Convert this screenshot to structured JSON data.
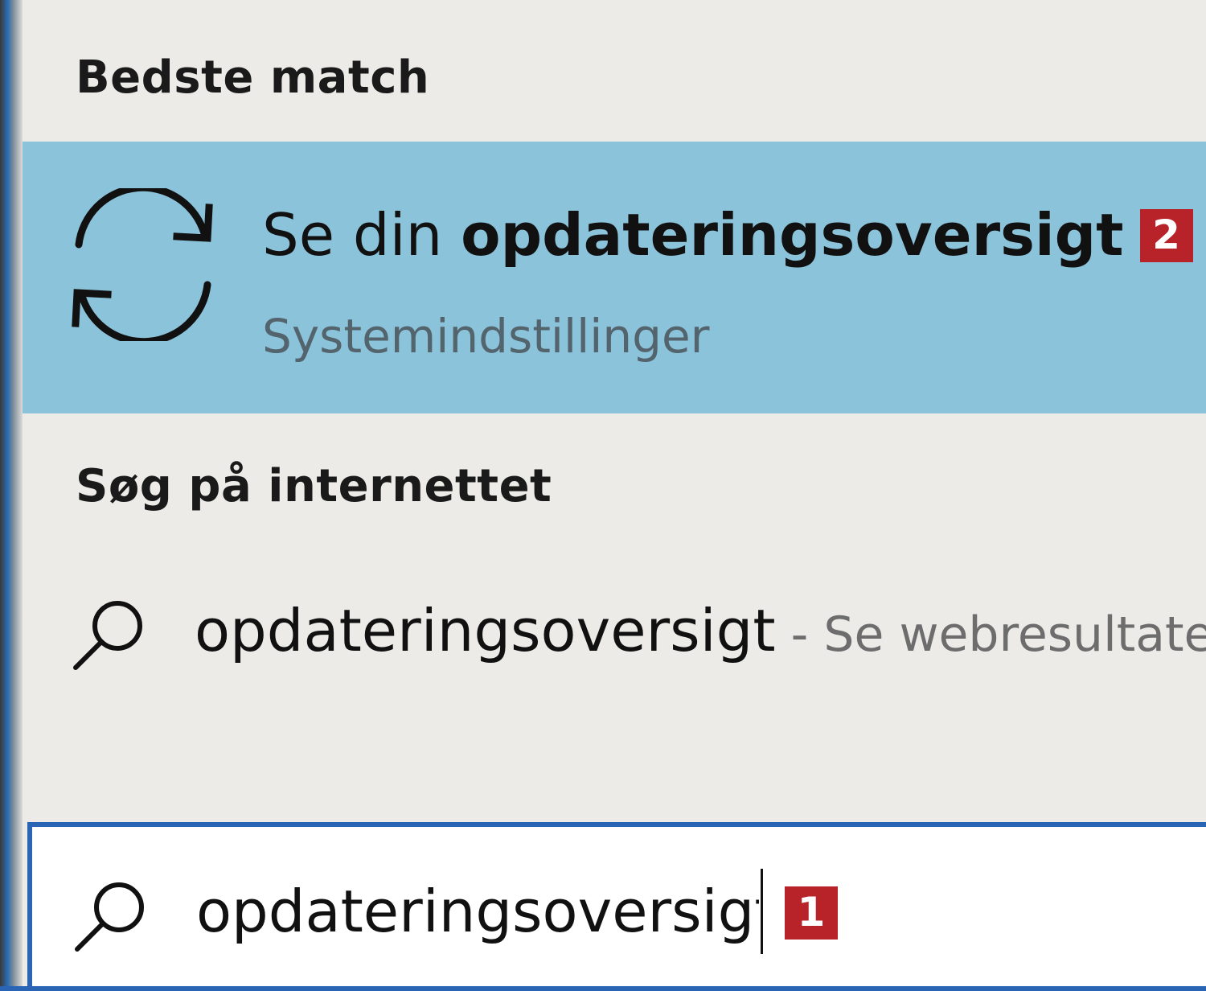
{
  "best_match": {
    "header": "Bedste match",
    "title_prefix": "Se din ",
    "title_bold": "opdateringsoversigt",
    "badge": "2",
    "subtitle": "Systemindstillinger",
    "icon": "sync-icon"
  },
  "web": {
    "header": "Søg på internettet",
    "query": "opdateringsoversigt",
    "suffix": " - Se webresultater",
    "icon": "search-icon"
  },
  "search": {
    "value": "opdateringsoversigt",
    "badge": "1",
    "icon": "search-icon"
  },
  "colors": {
    "highlight": "#8bc3db",
    "accent": "#2a64b5",
    "badge": "#b8232a",
    "panel": "#ecebe8"
  }
}
